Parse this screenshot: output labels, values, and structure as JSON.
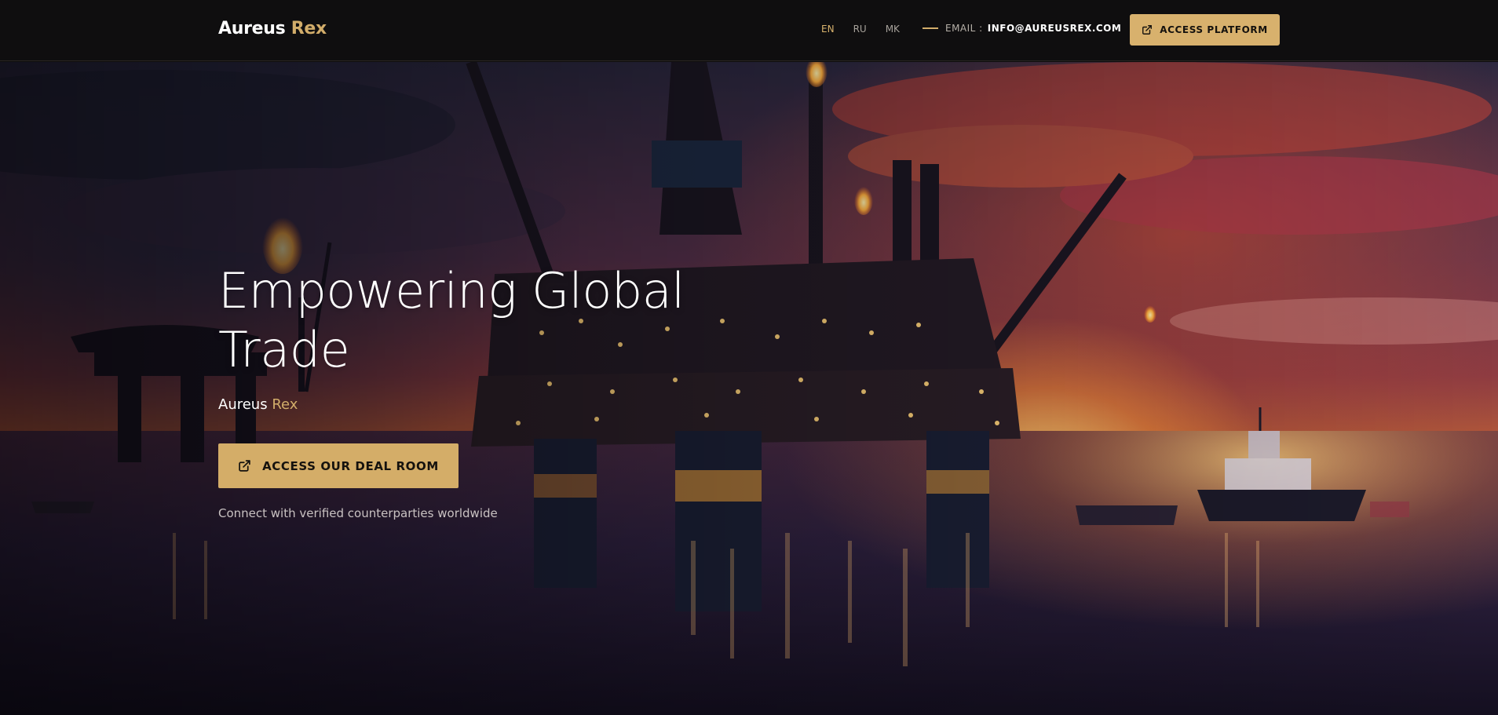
{
  "header": {
    "brand": {
      "word1": "Aureus",
      "word2": "Rex"
    },
    "languages": [
      {
        "code": "EN",
        "active": true
      },
      {
        "code": "RU",
        "active": false
      },
      {
        "code": "MK",
        "active": false
      }
    ],
    "email_label": "EMAIL :",
    "email_value": "INFO@AUREUSREX.COM",
    "platform_button": {
      "label": "ACCESS PLATFORM",
      "icon": "external-link-icon"
    }
  },
  "hero": {
    "title_line1": "Empowering Global",
    "title_line2": "Trade",
    "brand": {
      "word1": "Aureus",
      "word2": "Rex"
    },
    "cta": {
      "label": "ACCESS OUR DEAL ROOM",
      "icon": "external-link-icon"
    },
    "subtitle": "Connect with verified counterparties worldwide",
    "background": "offshore-oil-platform-sunset-image"
  },
  "colors": {
    "accent": "#d4ad68",
    "header_bg": "#0f0e0f",
    "text": "#ffffff"
  }
}
